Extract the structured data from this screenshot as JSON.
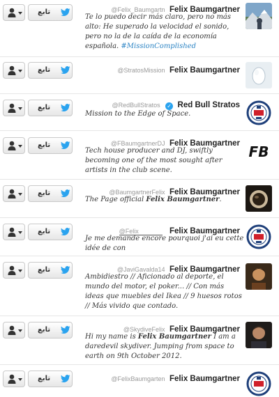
{
  "follow_label": "تابع",
  "accent_color": "#2c84c4",
  "twitter_blue": "#2aa3ef",
  "rows": [
    {
      "handle": "@Felix_Baumgartn",
      "name": "Felix Baumgartner",
      "bio": "Te lo puedo decir más claro, pero no más alto: He superado la velocidad el sonido, pero no la de la caída de la economía española.",
      "hashtag": "#MissionComplished",
      "verified": false,
      "avatar_icon": "mountain-photo"
    },
    {
      "handle": "@StratosMission",
      "name": "Felix Baumgartner",
      "bio": "",
      "verified": false,
      "avatar_icon": "default-egg"
    },
    {
      "handle": "@RedBullStratos",
      "name": "Red Bull Stratos",
      "bio": "Mission to the Edge of Space.",
      "verified": true,
      "avatar_icon": "stratos-emblem"
    },
    {
      "handle": "@FBaumgartnerDJ",
      "name": "Felix Baumgartner",
      "bio": "Tech house producer and DJ, swiftly becoming one of the most sought after artists in the club scene.",
      "verified": false,
      "avatar_icon": "fb-logo",
      "avatar_text": "FB"
    },
    {
      "handle": "@BaumgartnerFelix",
      "name": "Felix Baumgartner",
      "bio_prefix": "The Page official ",
      "bio_bold": "Felix Baumgartner",
      "bio_suffix": ".",
      "verified": false,
      "avatar_icon": "helmet-photo"
    },
    {
      "handle": "@Felix",
      "name": "Felix Baumgartner",
      "bio": "Je me demande encore pourquoi j'ai eu cette idée de con",
      "verified": false,
      "avatar_icon": "stratos-emblem"
    },
    {
      "handle": "@JaviGavalda14",
      "name": "Felix Baumgartner",
      "bio": "Ambidiestro // Aficionado al deporte, el mundo del motor, el poker... // Con más ideas que muebles del Ikea // 9 huesos rotos // Más vivido que contado.",
      "verified": false,
      "avatar_icon": "portrait-photo"
    },
    {
      "handle": "@SkydiveFelix",
      "name": "Felix Baumgartner",
      "bio_prefix": "Hi my name is ",
      "bio_bold": "Felix Baumgartner",
      "bio_suffix": " I am a daredevil skydiver. Jumping from space to earth on 9th October 2012.",
      "verified": false,
      "avatar_icon": "man-photo"
    },
    {
      "handle": "@FelixBaumgarten",
      "name": "Felix Baumgartner",
      "bio": "",
      "verified": false,
      "avatar_icon": "stratos-emblem"
    }
  ]
}
